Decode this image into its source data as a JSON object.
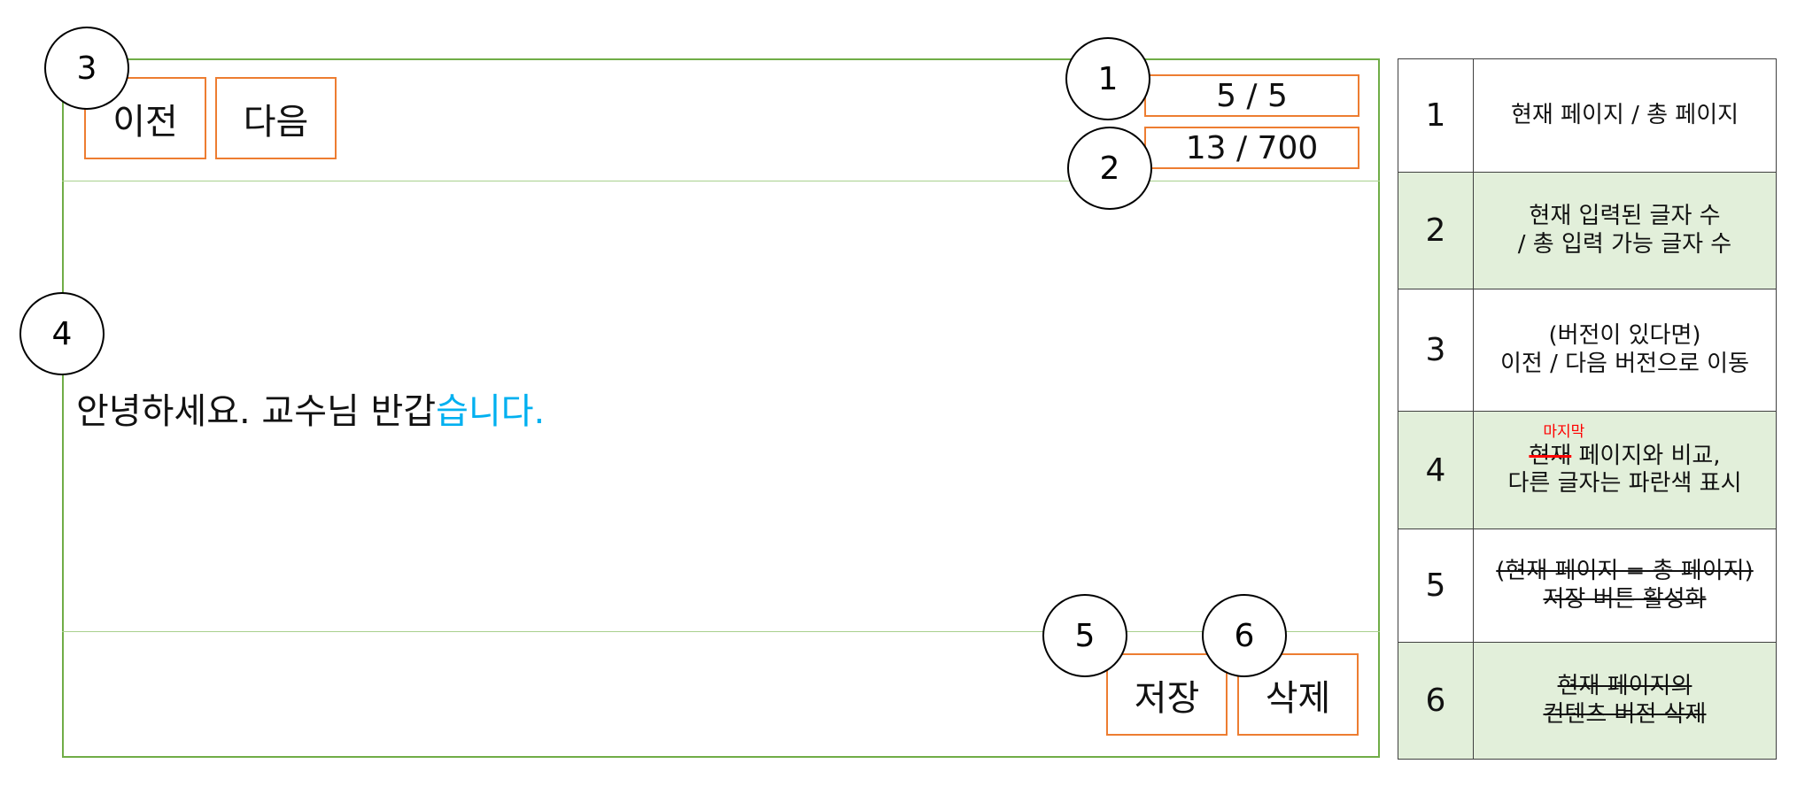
{
  "buttons": {
    "prev_label": "이전",
    "next_label": "다음",
    "save_label": "저장",
    "delete_label": "삭제"
  },
  "indicators": {
    "page_counter": "5 / 5",
    "char_counter": "13 / 700"
  },
  "content": {
    "text_plain": "안녕하세요. 교수님 반갑",
    "text_highlight": "습니다."
  },
  "markers": [
    "1",
    "2",
    "3",
    "4",
    "5",
    "6"
  ],
  "legend": {
    "rows": [
      {
        "num": "1",
        "lines": [
          "현재 페이지 / 총 페이지"
        ]
      },
      {
        "num": "2",
        "lines": [
          "현재 입력된 글자 수",
          "/ 총 입력 가능 글자 수"
        ]
      },
      {
        "num": "3",
        "lines": [
          "(버전이 있다면)",
          "이전 / 다음 버전으로 이동"
        ]
      },
      {
        "num": "4",
        "struck_word": "현재",
        "insert_word": "마지막",
        "line1_rest": " 페이지와 비교,",
        "line2": "다른 글자는 파란색 표시"
      },
      {
        "num": "5",
        "lines": [
          "(현재 페이지 = 총 페이지)",
          "저장 버튼 활성화"
        ]
      },
      {
        "num": "6",
        "lines": [
          "현재 페이지의",
          "컨텐츠 버전 삭제"
        ]
      }
    ]
  },
  "colors": {
    "frame_border": "#70ad47",
    "button_border": "#ed7d31",
    "highlight_text": "#00b0f0",
    "legend_alt_row": "#e2efda",
    "annotation_red": "#ff0000"
  }
}
